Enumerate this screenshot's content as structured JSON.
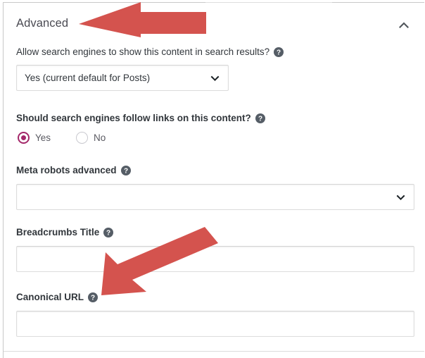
{
  "panel": {
    "section_title": "Advanced",
    "collapse_icon": "chevron-up-icon"
  },
  "fields": {
    "allow_search_engines": {
      "label": "Allow search engines to show this content in search results?",
      "help_icon": "help-circle-icon",
      "control": "select",
      "value": "Yes (current default for Posts)",
      "caret_icon": "chevron-down-icon"
    },
    "follow_links": {
      "label": "Should search engines follow links on this content?",
      "help_icon": "help-circle-icon",
      "control": "radio-group",
      "options": [
        {
          "label": "Yes",
          "selected": true
        },
        {
          "label": "No",
          "selected": false
        }
      ]
    },
    "meta_robots_advanced": {
      "label": "Meta robots advanced",
      "help_icon": "help-circle-icon",
      "control": "select",
      "value": "",
      "caret_icon": "chevron-down-icon"
    },
    "breadcrumbs_title": {
      "label": "Breadcrumbs Title",
      "help_icon": "help-circle-icon",
      "control": "text",
      "value": "",
      "placeholder": ""
    },
    "canonical_url": {
      "label": "Canonical URL",
      "help_icon": "help-circle-icon",
      "control": "text",
      "value": "",
      "placeholder": ""
    }
  },
  "annotations": [
    {
      "name": "arrow-pointing-to-advanced-header",
      "direction": "left",
      "color": "#d4534e"
    },
    {
      "name": "arrow-pointing-to-canonical-url",
      "direction": "down-left",
      "color": "#d4534e"
    }
  ],
  "colors": {
    "accent_pink": "#a4286a",
    "annotation_red": "#d4534e",
    "label_text": "#32373c",
    "title_text": "#4a4a52",
    "border": "#dcdcdc"
  }
}
